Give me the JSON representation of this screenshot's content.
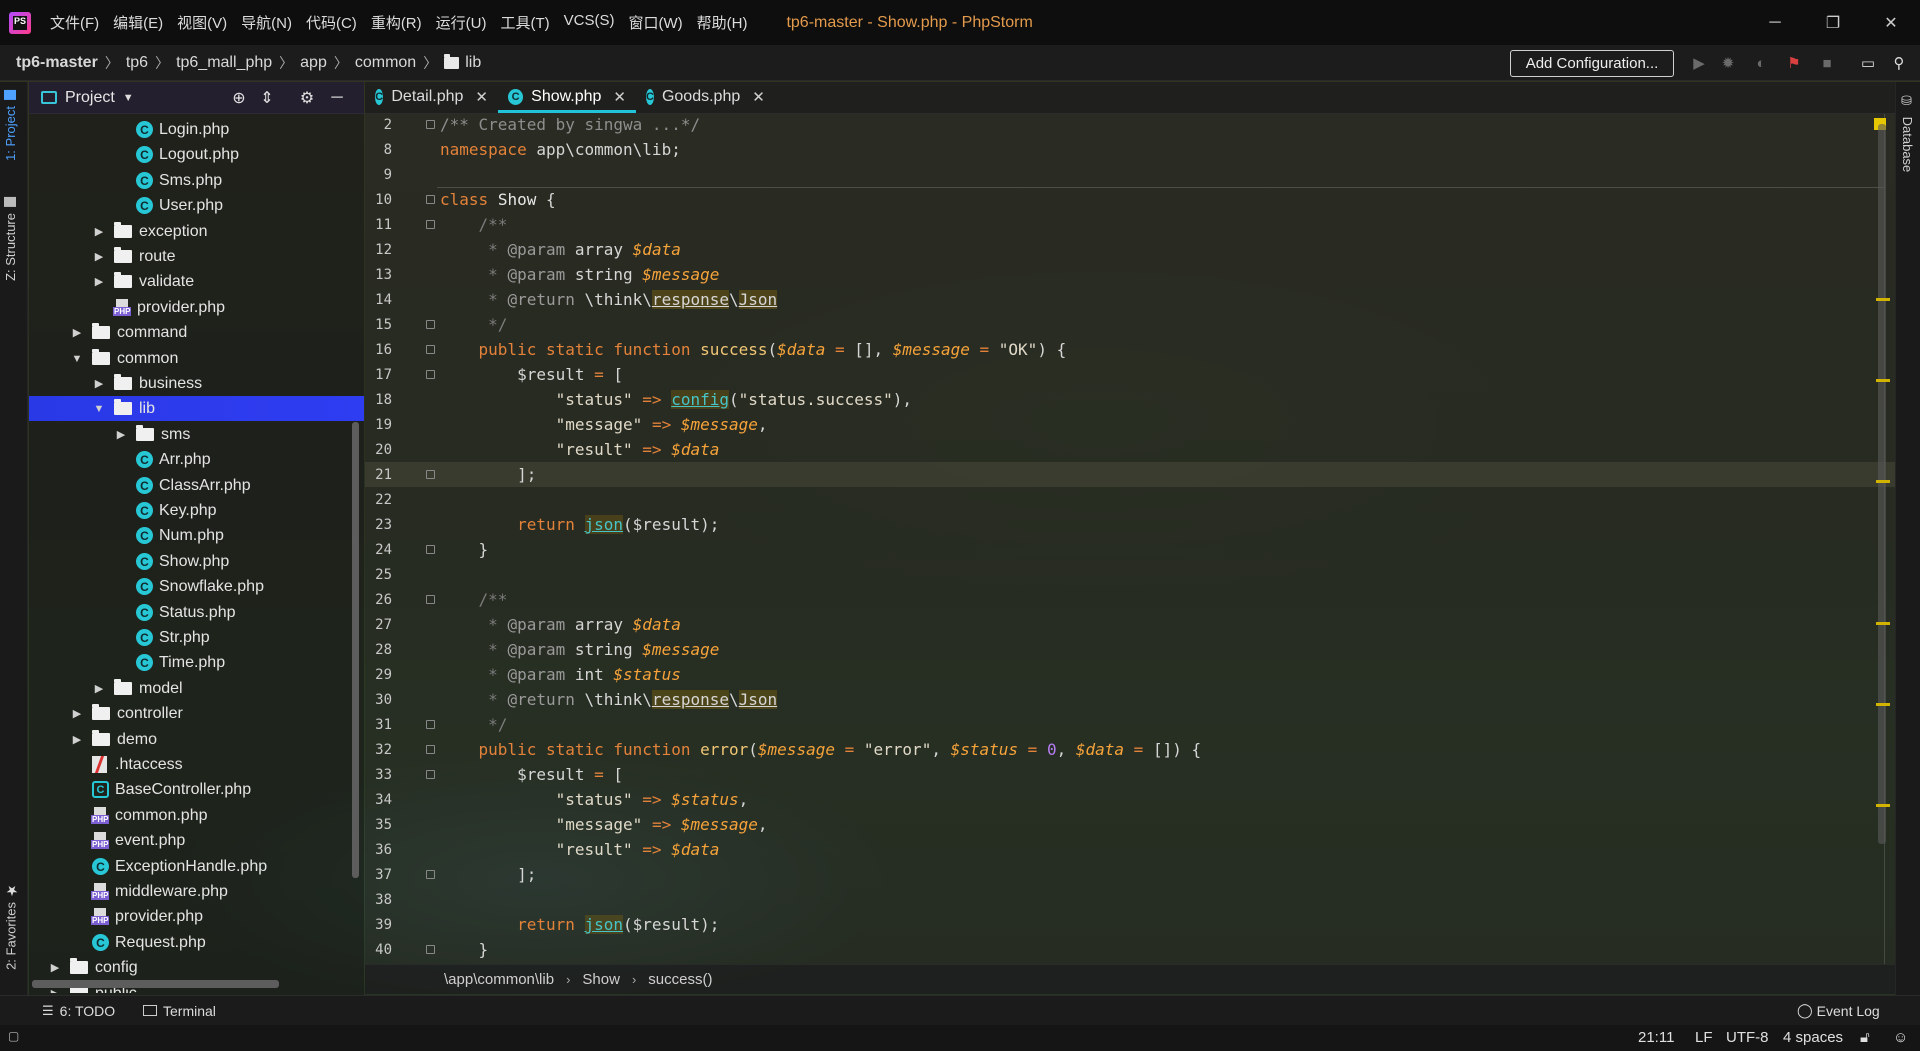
{
  "window": {
    "app_icon": "phpstorm-logo-icon",
    "title": "tp6-master - Show.php - PhpStorm",
    "menu": [
      "文件(F)",
      "编辑(E)",
      "视图(V)",
      "导航(N)",
      "代码(C)",
      "重构(R)",
      "运行(U)",
      "工具(T)",
      "VCS(S)",
      "窗口(W)",
      "帮助(H)"
    ],
    "controls": {
      "minimize": "─",
      "restore": "❐",
      "close": "✕"
    }
  },
  "nav": {
    "breadcrumb": [
      "tp6-master",
      "tp6",
      "tp6_mall_php",
      "app",
      "common",
      "lib"
    ],
    "add_configuration": "Add Configuration...",
    "icons": [
      "run-icon",
      "debug-icon",
      "coverage-icon",
      "vcs-icon",
      "stop-icon",
      "terminal-icon",
      "search-icon"
    ]
  },
  "left_strip": {
    "project_tab": "1: Project",
    "structure_tab": "Z: Structure",
    "favorites_tab": "2: Favorites"
  },
  "project": {
    "title": "Project",
    "tree": [
      {
        "label": "Login.php",
        "type": "class",
        "level": 5
      },
      {
        "label": "Logout.php",
        "type": "class",
        "level": 5
      },
      {
        "label": "Sms.php",
        "type": "class",
        "level": 5
      },
      {
        "label": "User.php",
        "type": "class",
        "level": 5
      },
      {
        "label": "exception",
        "type": "folder",
        "level": 4,
        "arrow": "▶"
      },
      {
        "label": "route",
        "type": "folder",
        "level": 4,
        "arrow": "▶"
      },
      {
        "label": "validate",
        "type": "folder",
        "level": 4,
        "arrow": "▶"
      },
      {
        "label": "provider.php",
        "type": "php",
        "level": 4
      },
      {
        "label": "command",
        "type": "folder",
        "level": 3,
        "arrow": "▶"
      },
      {
        "label": "common",
        "type": "folder",
        "level": 3,
        "arrow": "▼"
      },
      {
        "label": "business",
        "type": "folder",
        "level": 4,
        "arrow": "▶"
      },
      {
        "label": "lib",
        "type": "folder",
        "level": 4,
        "arrow": "▼",
        "selected": true
      },
      {
        "label": "sms",
        "type": "folder",
        "level": 5,
        "arrow": "▶"
      },
      {
        "label": "Arr.php",
        "type": "class",
        "level": 5
      },
      {
        "label": "ClassArr.php",
        "type": "class",
        "level": 5
      },
      {
        "label": "Key.php",
        "type": "class",
        "level": 5
      },
      {
        "label": "Num.php",
        "type": "class",
        "level": 5
      },
      {
        "label": "Show.php",
        "type": "class",
        "level": 5
      },
      {
        "label": "Snowflake.php",
        "type": "class",
        "level": 5
      },
      {
        "label": "Status.php",
        "type": "class",
        "level": 5
      },
      {
        "label": "Str.php",
        "type": "class",
        "level": 5
      },
      {
        "label": "Time.php",
        "type": "class",
        "level": 5
      },
      {
        "label": "model",
        "type": "folder",
        "level": 4,
        "arrow": "▶"
      },
      {
        "label": "controller",
        "type": "folder",
        "level": 3,
        "arrow": "▶"
      },
      {
        "label": "demo",
        "type": "folder",
        "level": 3,
        "arrow": "▶"
      },
      {
        "label": ".htaccess",
        "type": "htaccess",
        "level": 3
      },
      {
        "label": "BaseController.php",
        "type": "classfile",
        "level": 3
      },
      {
        "label": "common.php",
        "type": "php",
        "level": 3
      },
      {
        "label": "event.php",
        "type": "php",
        "level": 3
      },
      {
        "label": "ExceptionHandle.php",
        "type": "class",
        "level": 3
      },
      {
        "label": "middleware.php",
        "type": "php",
        "level": 3
      },
      {
        "label": "provider.php",
        "type": "php",
        "level": 3
      },
      {
        "label": "Request.php",
        "type": "class",
        "level": 3
      },
      {
        "label": "config",
        "type": "folder",
        "level": 2,
        "arrow": "▶"
      },
      {
        "label": "public",
        "type": "folder",
        "level": 2,
        "arrow": "▶"
      }
    ]
  },
  "tabs": [
    {
      "label": "Detail.php",
      "active": false
    },
    {
      "label": "Show.php",
      "active": true
    },
    {
      "label": "Goods.php",
      "active": false
    }
  ],
  "editor": {
    "current_line": "21",
    "lines": [
      {
        "n": "2",
        "html": "<span class='cmt'>/** Created by singwa ...*/</span>",
        "fold": true
      },
      {
        "n": "8",
        "html": "<span class='kw'>namespace</span> app\\common\\lib;"
      },
      {
        "n": "9",
        "html": ""
      },
      {
        "n": "10",
        "html": "<span class='kw'>class</span> <span class='cls'>Show</span> {",
        "fold": true
      },
      {
        "n": "11",
        "html": "    <span class='doc'>/**</span>",
        "fold": true
      },
      {
        "n": "12",
        "html": "     <span class='doc'>* </span><span class='dtag'>@param</span> array <span class='var'>$data</span>"
      },
      {
        "n": "13",
        "html": "     <span class='doc'>* </span><span class='dtag'>@param</span> string <span class='var'>$message</span>"
      },
      {
        "n": "14",
        "html": "     <span class='doc'>* </span><span class='dtag'>@return</span> \\think\\<span class='ul'>response</span>\\<span class='ul'>Json</span>"
      },
      {
        "n": "15",
        "html": "     <span class='doc'>*/</span>",
        "fold": true
      },
      {
        "n": "16",
        "html": "    <span class='kw'>public static function</span> <span class='fn'>success</span>(<span class='var'>$data</span> <span class='opr'>=</span> [], <span class='var'>$message</span> <span class='opr'>=</span> <span class='str'>\"OK\"</span>) {",
        "fold": true
      },
      {
        "n": "17",
        "html": "        $result <span class='opr'>=</span> [",
        "fold": true
      },
      {
        "n": "18",
        "html": "            <span class='str'>\"status\"</span> <span class='opr'>=></span> <span class='ulc'>config</span>(<span class='str'>\"status.success\"</span>),"
      },
      {
        "n": "19",
        "html": "            <span class='str'>\"message\"</span> <span class='opr'>=></span> <span class='var'>$message</span>,"
      },
      {
        "n": "20",
        "html": "            <span class='str'>\"result\"</span> <span class='opr'>=></span> <span class='var'>$data</span>"
      },
      {
        "n": "21",
        "html": "        ];",
        "fold": true,
        "current": true
      },
      {
        "n": "22",
        "html": ""
      },
      {
        "n": "23",
        "html": "        <span class='kw'>return</span> <span class='ulc'>json</span>($result);"
      },
      {
        "n": "24",
        "html": "    }",
        "fold": true
      },
      {
        "n": "25",
        "html": ""
      },
      {
        "n": "26",
        "html": "    <span class='doc'>/**</span>",
        "fold": true
      },
      {
        "n": "27",
        "html": "     <span class='doc'>* </span><span class='dtag'>@param</span> array <span class='var'>$data</span>"
      },
      {
        "n": "28",
        "html": "     <span class='doc'>* </span><span class='dtag'>@param</span> string <span class='var'>$message</span>"
      },
      {
        "n": "29",
        "html": "     <span class='doc'>* </span><span class='dtag'>@param</span> int <span class='var'>$status</span>"
      },
      {
        "n": "30",
        "html": "     <span class='doc'>* </span><span class='dtag'>@return</span> \\think\\<span class='ul'>response</span>\\<span class='ul'>Json</span>"
      },
      {
        "n": "31",
        "html": "     <span class='doc'>*/</span>",
        "fold": true
      },
      {
        "n": "32",
        "html": "    <span class='kw'>public static function</span> <span class='fn'>error</span>(<span class='var'>$message</span> <span class='opr'>=</span> <span class='str'>\"error\"</span>, <span class='var'>$status</span> <span class='opr'>=</span> <span class='num'>0</span>, <span class='var'>$data</span> <span class='opr'>=</span> []) {",
        "fold": true
      },
      {
        "n": "33",
        "html": "        $result <span class='opr'>=</span> [",
        "fold": true
      },
      {
        "n": "34",
        "html": "            <span class='str'>\"status\"</span> <span class='opr'>=></span> <span class='var'>$status</span>,"
      },
      {
        "n": "35",
        "html": "            <span class='str'>\"message\"</span> <span class='opr'>=></span> <span class='var'>$message</span>,"
      },
      {
        "n": "36",
        "html": "            <span class='str'>\"result\"</span> <span class='opr'>=></span> <span class='var'>$data</span>"
      },
      {
        "n": "37",
        "html": "        ];",
        "fold": true
      },
      {
        "n": "38",
        "html": ""
      },
      {
        "n": "39",
        "html": "        <span class='kw'>return</span> <span class='ulc'>json</span>($result);"
      },
      {
        "n": "40",
        "html": "    }",
        "fold": true
      }
    ]
  },
  "code_breadcrumb": [
    "\\app\\common\\lib",
    "Show",
    "success()"
  ],
  "right_strip": {
    "database_tab": "Database"
  },
  "bottom_tools": {
    "todo": "6: TODO",
    "terminal": "Terminal",
    "event_log": "Event Log"
  },
  "status": {
    "position": "21:11",
    "line_sep": "LF",
    "encoding": "UTF-8",
    "indent": "4 spaces"
  },
  "colors": {
    "accent": "#21c3d8",
    "selection": "#2f3df2",
    "keyword": "#e3823a",
    "variable": "#f6a33a",
    "title": "#e39a4c"
  }
}
